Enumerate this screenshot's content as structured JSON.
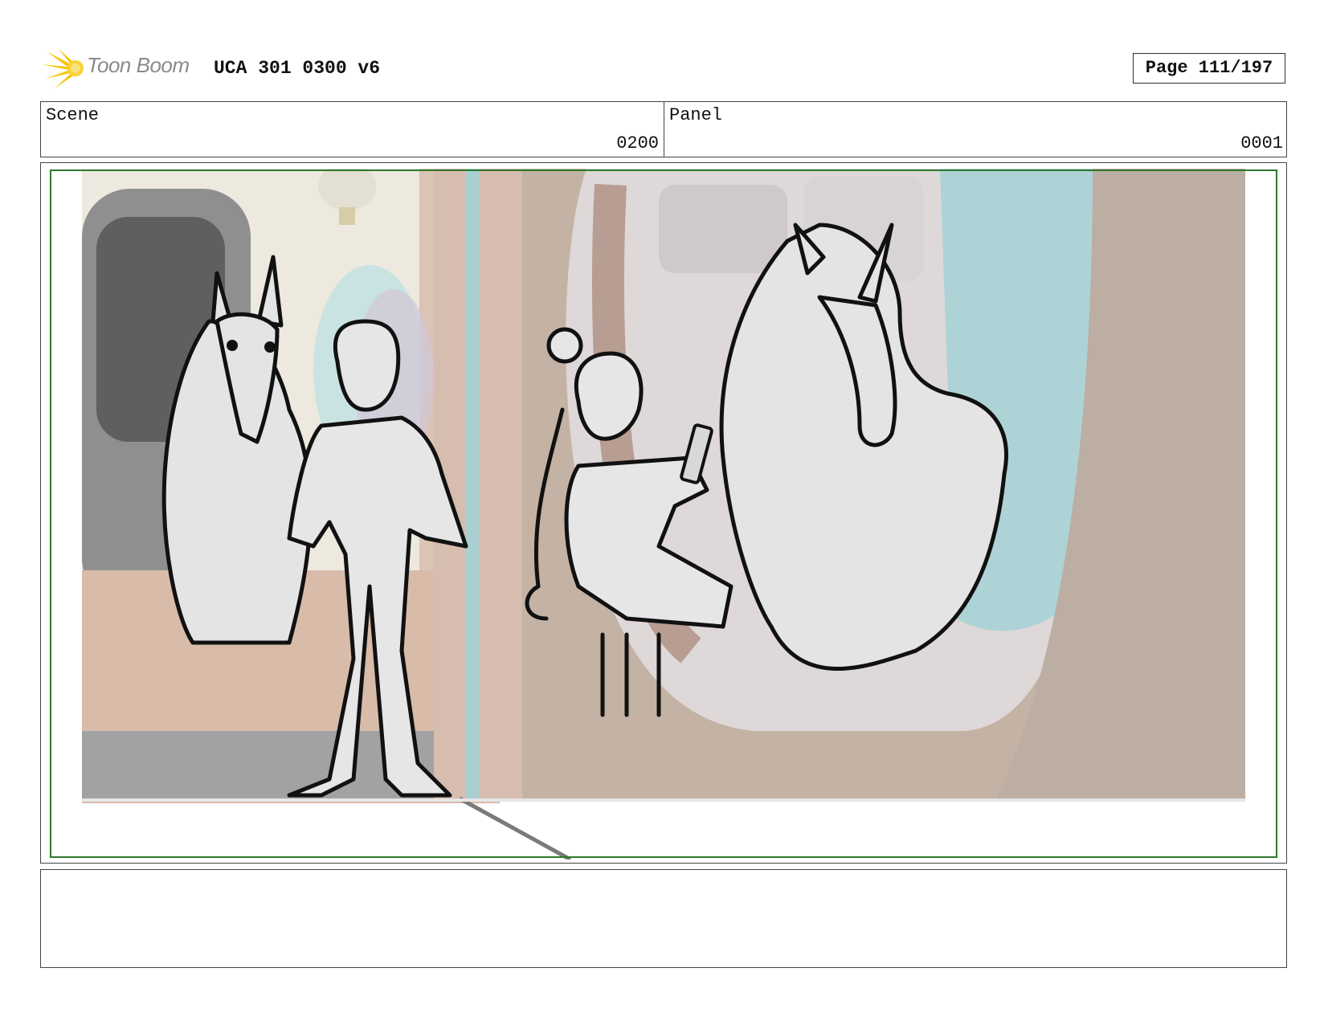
{
  "header": {
    "logo_text": "Toon Boom",
    "document_title": "UCA 301 0300 v6",
    "page": "Page 111/197"
  },
  "info": {
    "scene_label": "Scene",
    "scene_value": "0200",
    "panel_label": "Panel",
    "panel_value": "0001"
  },
  "colors": {
    "frame_border": "#444444",
    "safe_area_border": "#2d7a2d",
    "logo_accent": "#f5c400"
  },
  "artwork": {
    "icon": "storyboard-sketch-image"
  }
}
